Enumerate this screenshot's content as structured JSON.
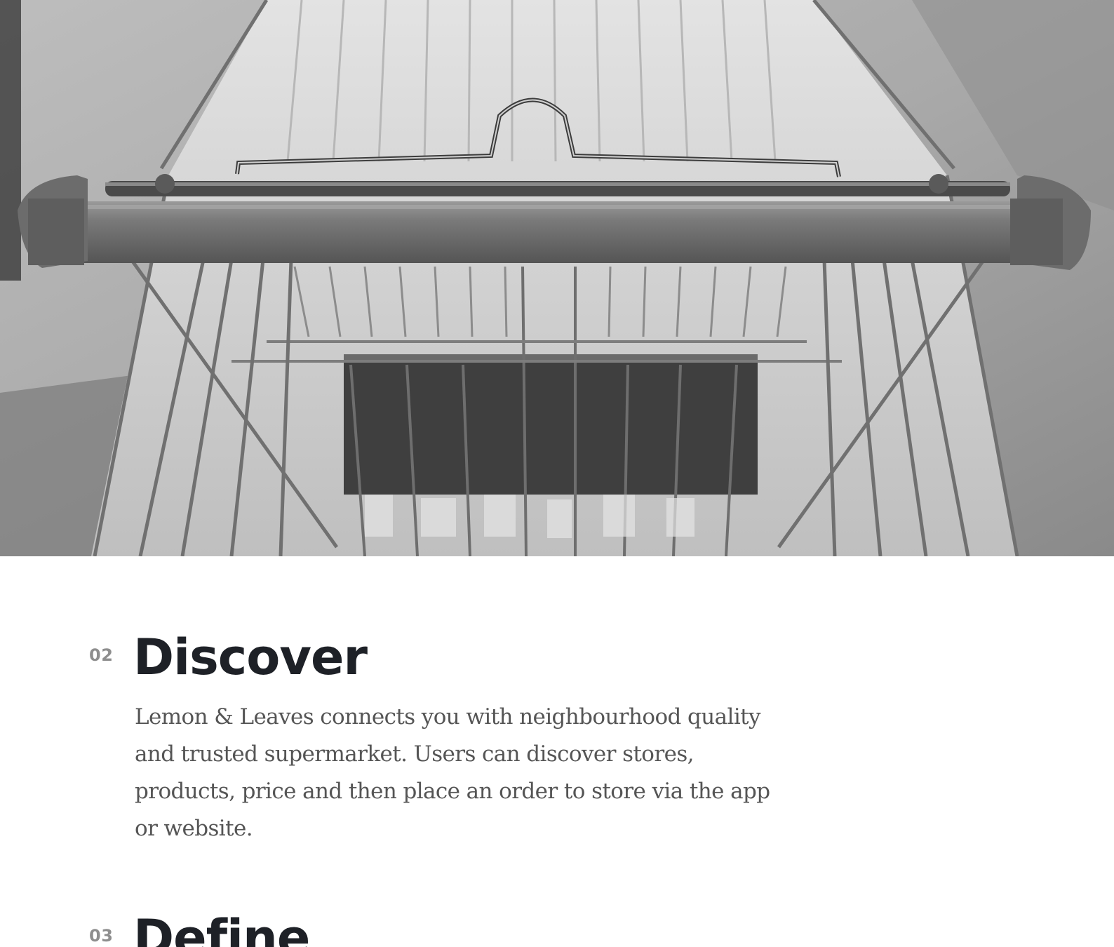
{
  "hero": {
    "image_name": "shopping-cart-photo"
  },
  "sections": [
    {
      "number": "02",
      "title": "Discover",
      "body": "Lemon & Leaves connects you with neighbourhood quality and trusted supermarket. Users can discover stores, products, price and then place an order to store via the app or website."
    },
    {
      "number": "03",
      "title": "Define"
    }
  ]
}
